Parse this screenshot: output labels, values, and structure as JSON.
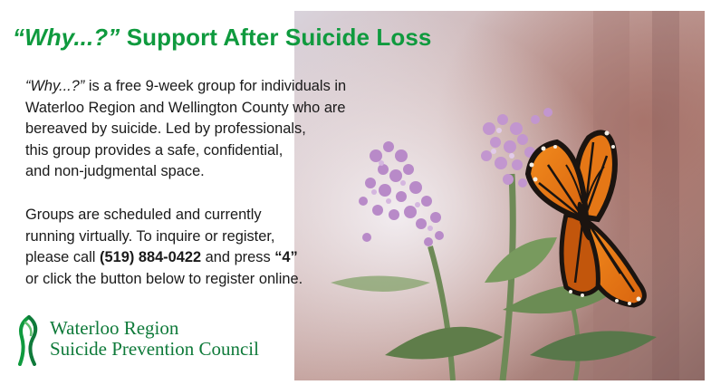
{
  "title": {
    "italic_part": "“Why...?”",
    "rest": " Support After Suicide Loss"
  },
  "paragraph1": {
    "line1_italic": "“Why...?”",
    "line1_rest": " is a free 9-week group for individuals in",
    "line2": "Waterloo Region and Wellington County who are",
    "line3": "bereaved by suicide. Led by professionals,",
    "line4": "this group provides a safe, confidential,",
    "line5": "and non-judgmental space."
  },
  "paragraph2": {
    "line1": "Groups are scheduled and currently",
    "line2": "running virtually. To inquire or register,",
    "line3_pre": "please call ",
    "phone": "(519) 884-0422",
    "line3_mid": " and press ",
    "press_key": "“4”",
    "line4": "or click the button below to register online."
  },
  "logo": {
    "line1": "Waterloo Region",
    "line2": "Suicide Prevention Council"
  },
  "colors": {
    "brand_green": "#0f9a3e",
    "logo_green": "#0f7a3a"
  },
  "photo": {
    "subject": "monarch-butterfly-on-purple-flowers"
  }
}
